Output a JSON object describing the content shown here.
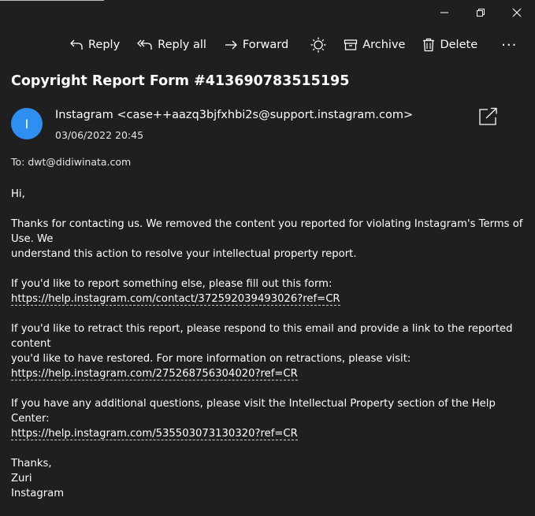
{
  "window": {
    "minimize": "minimize",
    "restore": "restore",
    "close": "close"
  },
  "toolbar": {
    "reply": "Reply",
    "reply_all": "Reply all",
    "forward": "Forward",
    "archive": "Archive",
    "delete": "Delete",
    "more": "···"
  },
  "message": {
    "subject": "Copyright Report Form #413690783515195",
    "avatar_initial": "I",
    "sender": "Instagram <case++aazq3bjfxhbi2s@support.instagram.com>",
    "date": "03/06/2022 20:45",
    "to": "To: dwt@didiwinata.com"
  },
  "body": {
    "greeting": "Hi,",
    "para1_line1": "Thanks for contacting us. We removed the content you reported for violating Instagram's Terms of Use. We",
    "para1_line2": "understand this action to resolve your intellectual property report.",
    "para2_line1": "If you'd like to report something else, please fill out this form:",
    "link1": "https://help.instagram.com/contact/372592039493026?ref=CR",
    "para3_line1": "If you'd like to retract this report, please respond to this email and provide a link to the reported content",
    "para3_line2": "you'd like to have restored. For more information on retractions, please visit:",
    "link2": "https://help.instagram.com/275268756304020?ref=CR",
    "para4_line1": "If you have any additional questions, please visit the Intellectual Property section of the Help Center:",
    "link3": "https://help.instagram.com/535503073130320?ref=CR",
    "signoff1": "Thanks,",
    "signoff2": "Zuri",
    "signoff3": "Instagram"
  },
  "colors": {
    "background": "#1f1f1f",
    "avatar": "#2f8ef2",
    "text": "#ffffff"
  }
}
